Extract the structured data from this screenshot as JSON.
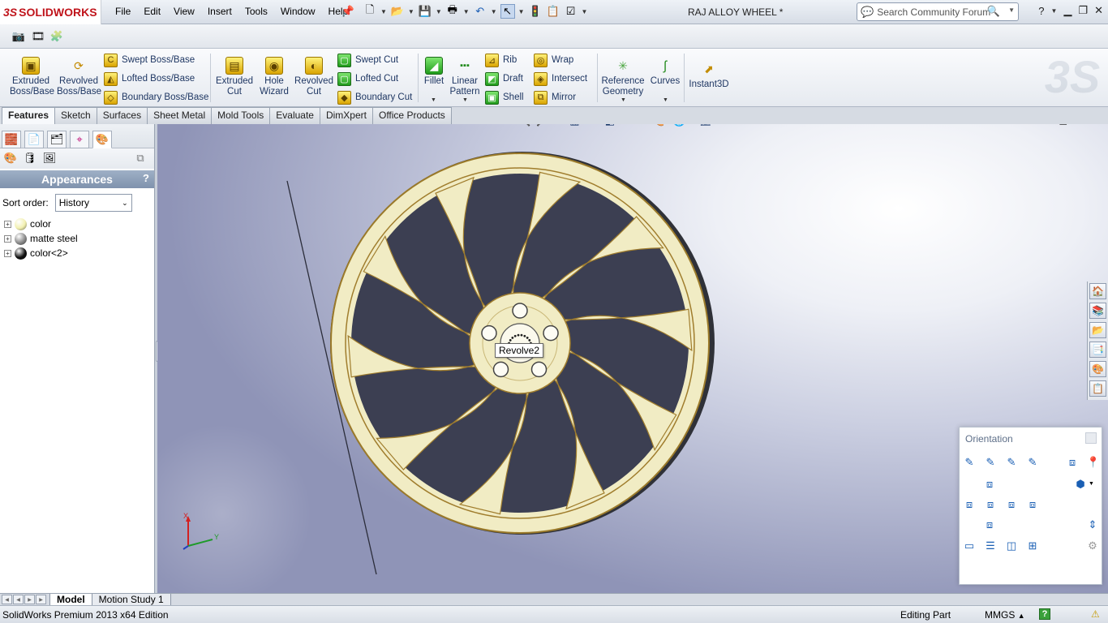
{
  "app": {
    "logo_ds": "3S",
    "logo_name": "SOLIDWORKS",
    "document_title": "RAJ ALLOY WHEEL *"
  },
  "menu": [
    "File",
    "Edit",
    "View",
    "Insert",
    "Tools",
    "Window",
    "Help"
  ],
  "search": {
    "placeholder": "Search Community Forum"
  },
  "commands": {
    "extruded_boss": "Extruded\nBoss/Base",
    "revolved_boss": "Revolved\nBoss/Base",
    "swept_boss": "Swept Boss/Base",
    "lofted_boss": "Lofted Boss/Base",
    "boundary_boss": "Boundary Boss/Base",
    "extruded_cut": "Extruded\nCut",
    "hole_wizard": "Hole\nWizard",
    "revolved_cut": "Revolved\nCut",
    "swept_cut": "Swept Cut",
    "lofted_cut": "Lofted Cut",
    "boundary_cut": "Boundary Cut",
    "fillet": "Fillet",
    "linear_pattern": "Linear\nPattern",
    "rib": "Rib",
    "draft": "Draft",
    "shell": "Shell",
    "wrap": "Wrap",
    "intersect": "Intersect",
    "mirror": "Mirror",
    "reference_geometry": "Reference\nGeometry",
    "curves": "Curves",
    "instant3d": "Instant3D"
  },
  "tabs": [
    "Features",
    "Sketch",
    "Surfaces",
    "Sheet Metal",
    "Mold Tools",
    "Evaluate",
    "DimXpert",
    "Office Products"
  ],
  "active_tab": "Features",
  "panel": {
    "title": "Appearances",
    "help": "?",
    "sort_label": "Sort order:",
    "sort_value": "History",
    "items": [
      {
        "label": "color",
        "swatch": "#f2f0b0"
      },
      {
        "label": "matte steel",
        "swatch": "#8a8a8a"
      },
      {
        "label": "color<2>",
        "swatch": "#111111"
      }
    ]
  },
  "viewport": {
    "tooltip": "Revolve2",
    "wheel_color": "#f1ecc4",
    "axis_x": "X",
    "axis_y": "Y"
  },
  "orientation": {
    "title": "Orientation"
  },
  "bottom_tabs": [
    "Model",
    "Motion Study 1"
  ],
  "active_bottom_tab": "Model",
  "status": {
    "edition": "SolidWorks Premium 2013 x64 Edition",
    "mode": "Editing Part",
    "units": "MMGS"
  }
}
